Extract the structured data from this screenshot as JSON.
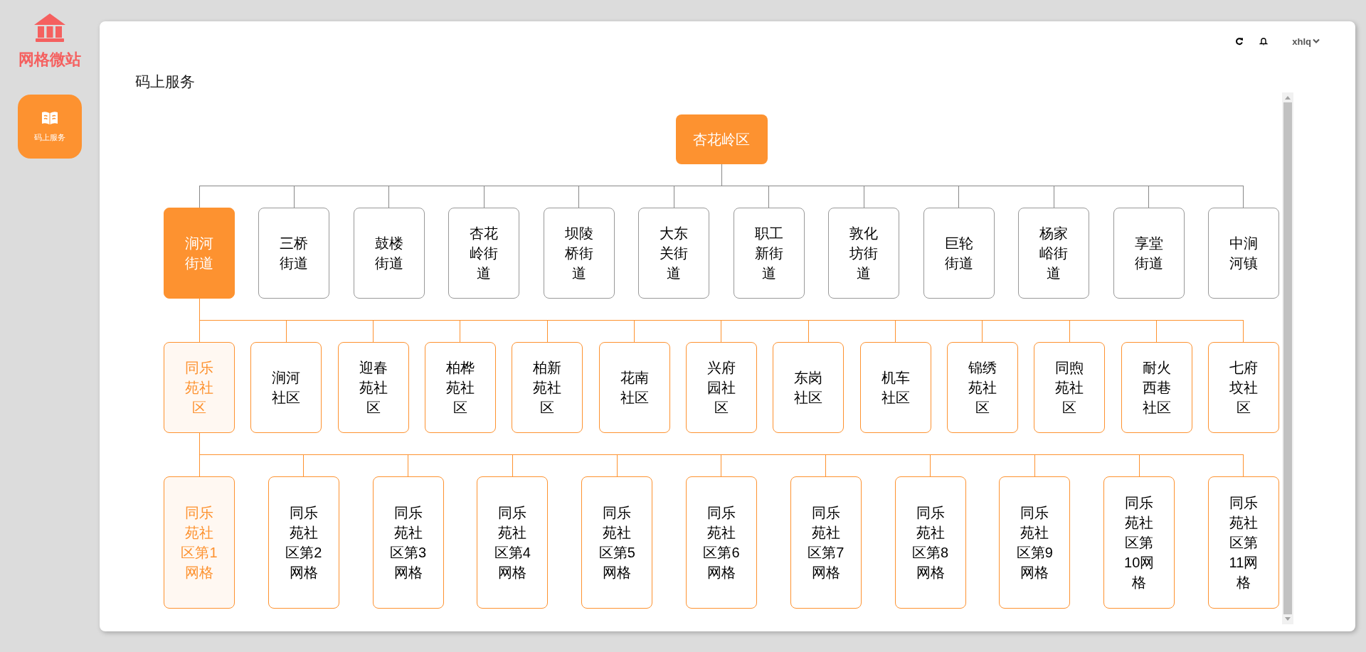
{
  "sidebar": {
    "logo_text": "网格微站",
    "menu": [
      {
        "label": "码上服务",
        "selected": true
      }
    ]
  },
  "header": {
    "user": "xhlq"
  },
  "page_title": "码上服务",
  "tree": {
    "label": "杏花岭区",
    "selected": true,
    "children": [
      {
        "label": "涧河街道",
        "selected": true,
        "children": [
          {
            "label": "同乐苑社区",
            "selected": true,
            "children": [
              {
                "label": "同乐苑社区第1网格",
                "selected": true
              },
              {
                "label": "同乐苑社区第2网格",
                "selected": false
              },
              {
                "label": "同乐苑社区第3网格",
                "selected": false
              },
              {
                "label": "同乐苑社区第4网格",
                "selected": false
              },
              {
                "label": "同乐苑社区第5网格",
                "selected": false
              },
              {
                "label": "同乐苑社区第6网格",
                "selected": false
              },
              {
                "label": "同乐苑社区第7网格",
                "selected": false
              },
              {
                "label": "同乐苑社区第8网格",
                "selected": false
              },
              {
                "label": "同乐苑社区第9网格",
                "selected": false
              },
              {
                "label": "同乐苑社区第10网格",
                "selected": false
              },
              {
                "label": "同乐苑社区第11网格",
                "selected": false
              }
            ]
          },
          {
            "label": "涧河社区",
            "selected": false
          },
          {
            "label": "迎春苑社区",
            "selected": false
          },
          {
            "label": "柏桦苑社区",
            "selected": false
          },
          {
            "label": "柏新苑社区",
            "selected": false
          },
          {
            "label": "花南社区",
            "selected": false
          },
          {
            "label": "兴府园社区",
            "selected": false
          },
          {
            "label": "东岗社区",
            "selected": false
          },
          {
            "label": "机车社区",
            "selected": false
          },
          {
            "label": "锦绣苑社区",
            "selected": false
          },
          {
            "label": "同煦苑社区",
            "selected": false
          },
          {
            "label": "耐火西巷社区",
            "selected": false
          },
          {
            "label": "七府坟社区",
            "selected": false
          }
        ]
      },
      {
        "label": "三桥街道",
        "selected": false
      },
      {
        "label": "鼓楼街道",
        "selected": false
      },
      {
        "label": "杏花岭街道",
        "selected": false
      },
      {
        "label": "坝陵桥街道",
        "selected": false
      },
      {
        "label": "大东关街道",
        "selected": false
      },
      {
        "label": "职工新街道",
        "selected": false
      },
      {
        "label": "敦化坊街道",
        "selected": false
      },
      {
        "label": "巨轮街道",
        "selected": false
      },
      {
        "label": "杨家峪街道",
        "selected": false
      },
      {
        "label": "享堂街道",
        "selected": false
      },
      {
        "label": "中涧河镇",
        "selected": false
      }
    ]
  }
}
